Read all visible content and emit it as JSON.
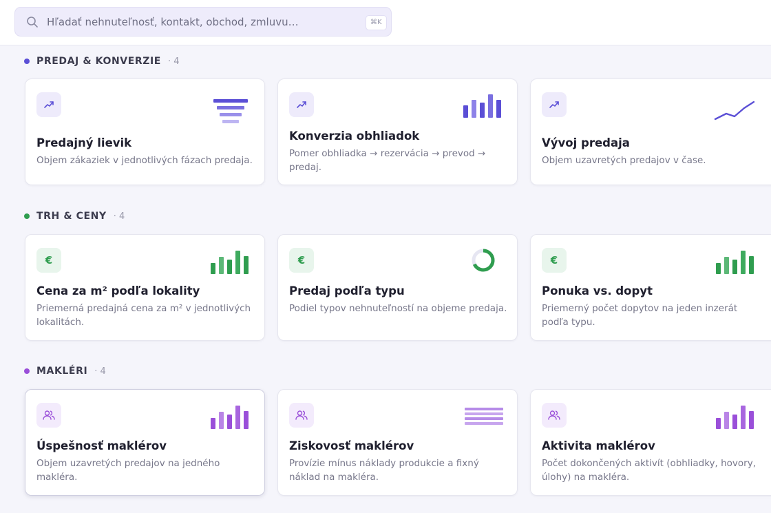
{
  "search": {
    "placeholder": "Hľadať nehnuteľnosť, kontakt, obchod, zmluvu…",
    "shortcut": "⌘K"
  },
  "colors": {
    "accent_purple": "#5b4fd6",
    "accent_green": "#2f9d4f",
    "accent_violet": "#9a4fd9"
  },
  "sections": [
    {
      "title": "PREDAJ & KONVERZIE",
      "count": "· 4",
      "color": "#5b4fd6",
      "icon": "trend-up-icon",
      "cards": [
        {
          "title": "Predajný lievik",
          "description": "Objem zákaziek v jednotlivých fázach predaja.",
          "visual": "funnel-icon"
        },
        {
          "title": "Konverzia obhliadok",
          "description": "Pomer obhliadka → rezervácia → prevod → predaj.",
          "visual": "bar-chart-icon"
        },
        {
          "title": "Vývoj predaja",
          "description": "Objem uzavretých predajov v čase.",
          "visual": "line-chart-icon"
        }
      ]
    },
    {
      "title": "TRH & CENY",
      "count": "· 4",
      "color": "#2f9d4f",
      "icon": "euro-icon",
      "cards": [
        {
          "title": "Cena za m² podľa lokality",
          "description": "Priemerná predajná cena za m² v jednotlivých lokalitách.",
          "visual": "bar-chart-icon"
        },
        {
          "title": "Predaj podľa typu",
          "description": "Podiel typov nehnuteľností na objeme predaja.",
          "visual": "donut-chart-icon"
        },
        {
          "title": "Ponuka vs. dopyt",
          "description": "Priemerný počet dopytov na jeden inzerát podľa typu.",
          "visual": "bar-chart-icon"
        }
      ]
    },
    {
      "title": "MAKLÉRI",
      "count": "· 4",
      "color": "#9a4fd9",
      "icon": "users-icon",
      "cards": [
        {
          "title": "Úspešnosť maklérov",
          "description": "Objem uzavretých predajov na jedného makléra.",
          "visual": "bar-chart-icon"
        },
        {
          "title": "Ziskovosť maklérov",
          "description": "Provízie mínus náklady produkcie a fixný náklad na makléra.",
          "visual": "table-lines-icon"
        },
        {
          "title": "Aktivita maklérov",
          "description": "Počet dokončených aktivít (obhliadky, hovory, úlohy) na makléra.",
          "visual": "bar-chart-icon"
        }
      ]
    }
  ]
}
